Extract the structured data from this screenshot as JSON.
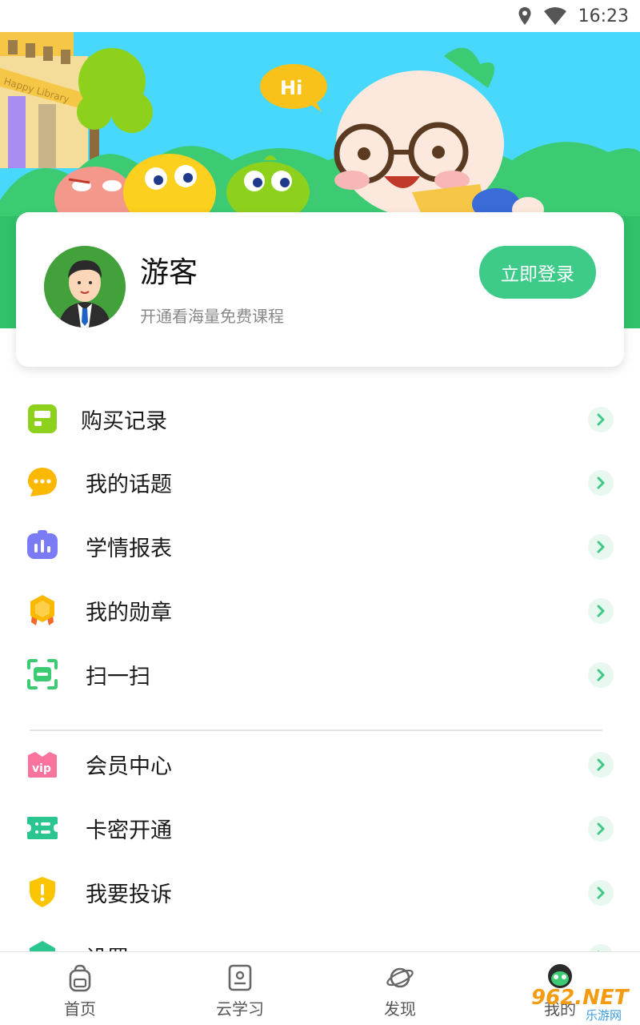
{
  "status_bar": {
    "time": "16:23",
    "icons": [
      "location-icon",
      "wifi-icon"
    ]
  },
  "banner": {
    "speech_bubble": "Hi",
    "building_sign": "Happy Library"
  },
  "profile": {
    "name": "游客",
    "subtitle": "开通看海量免费课程",
    "login_button": "立即登录"
  },
  "menu": {
    "group1": [
      {
        "label": "购买记录",
        "icon": "purchase-record-icon"
      },
      {
        "label": "我的话题",
        "icon": "topic-chat-icon"
      },
      {
        "label": "学情报表",
        "icon": "report-chart-icon"
      },
      {
        "label": "我的勋章",
        "icon": "medal-icon"
      },
      {
        "label": "扫一扫",
        "icon": "scan-icon"
      }
    ],
    "group2": [
      {
        "label": "会员中心",
        "icon": "vip-icon"
      },
      {
        "label": "卡密开通",
        "icon": "card-ticket-icon"
      },
      {
        "label": "我要投诉",
        "icon": "complaint-shield-icon"
      },
      {
        "label": "设置",
        "icon": "settings-icon"
      }
    ]
  },
  "bottom_nav": [
    {
      "label": "首页",
      "icon": "backpack-home-icon"
    },
    {
      "label": "云学习",
      "icon": "cloud-study-icon"
    },
    {
      "label": "发现",
      "icon": "planet-discover-icon"
    },
    {
      "label": "我的",
      "icon": "mascot-profile-icon"
    }
  ],
  "watermark": {
    "text": "962.NET",
    "subtext": "乐游网"
  },
  "colors": {
    "accent_green": "#3ecb89",
    "banner_sky": "#47d8fb",
    "banner_grass": "#3ccb73",
    "arrow_bg": "#e9f8ef"
  }
}
